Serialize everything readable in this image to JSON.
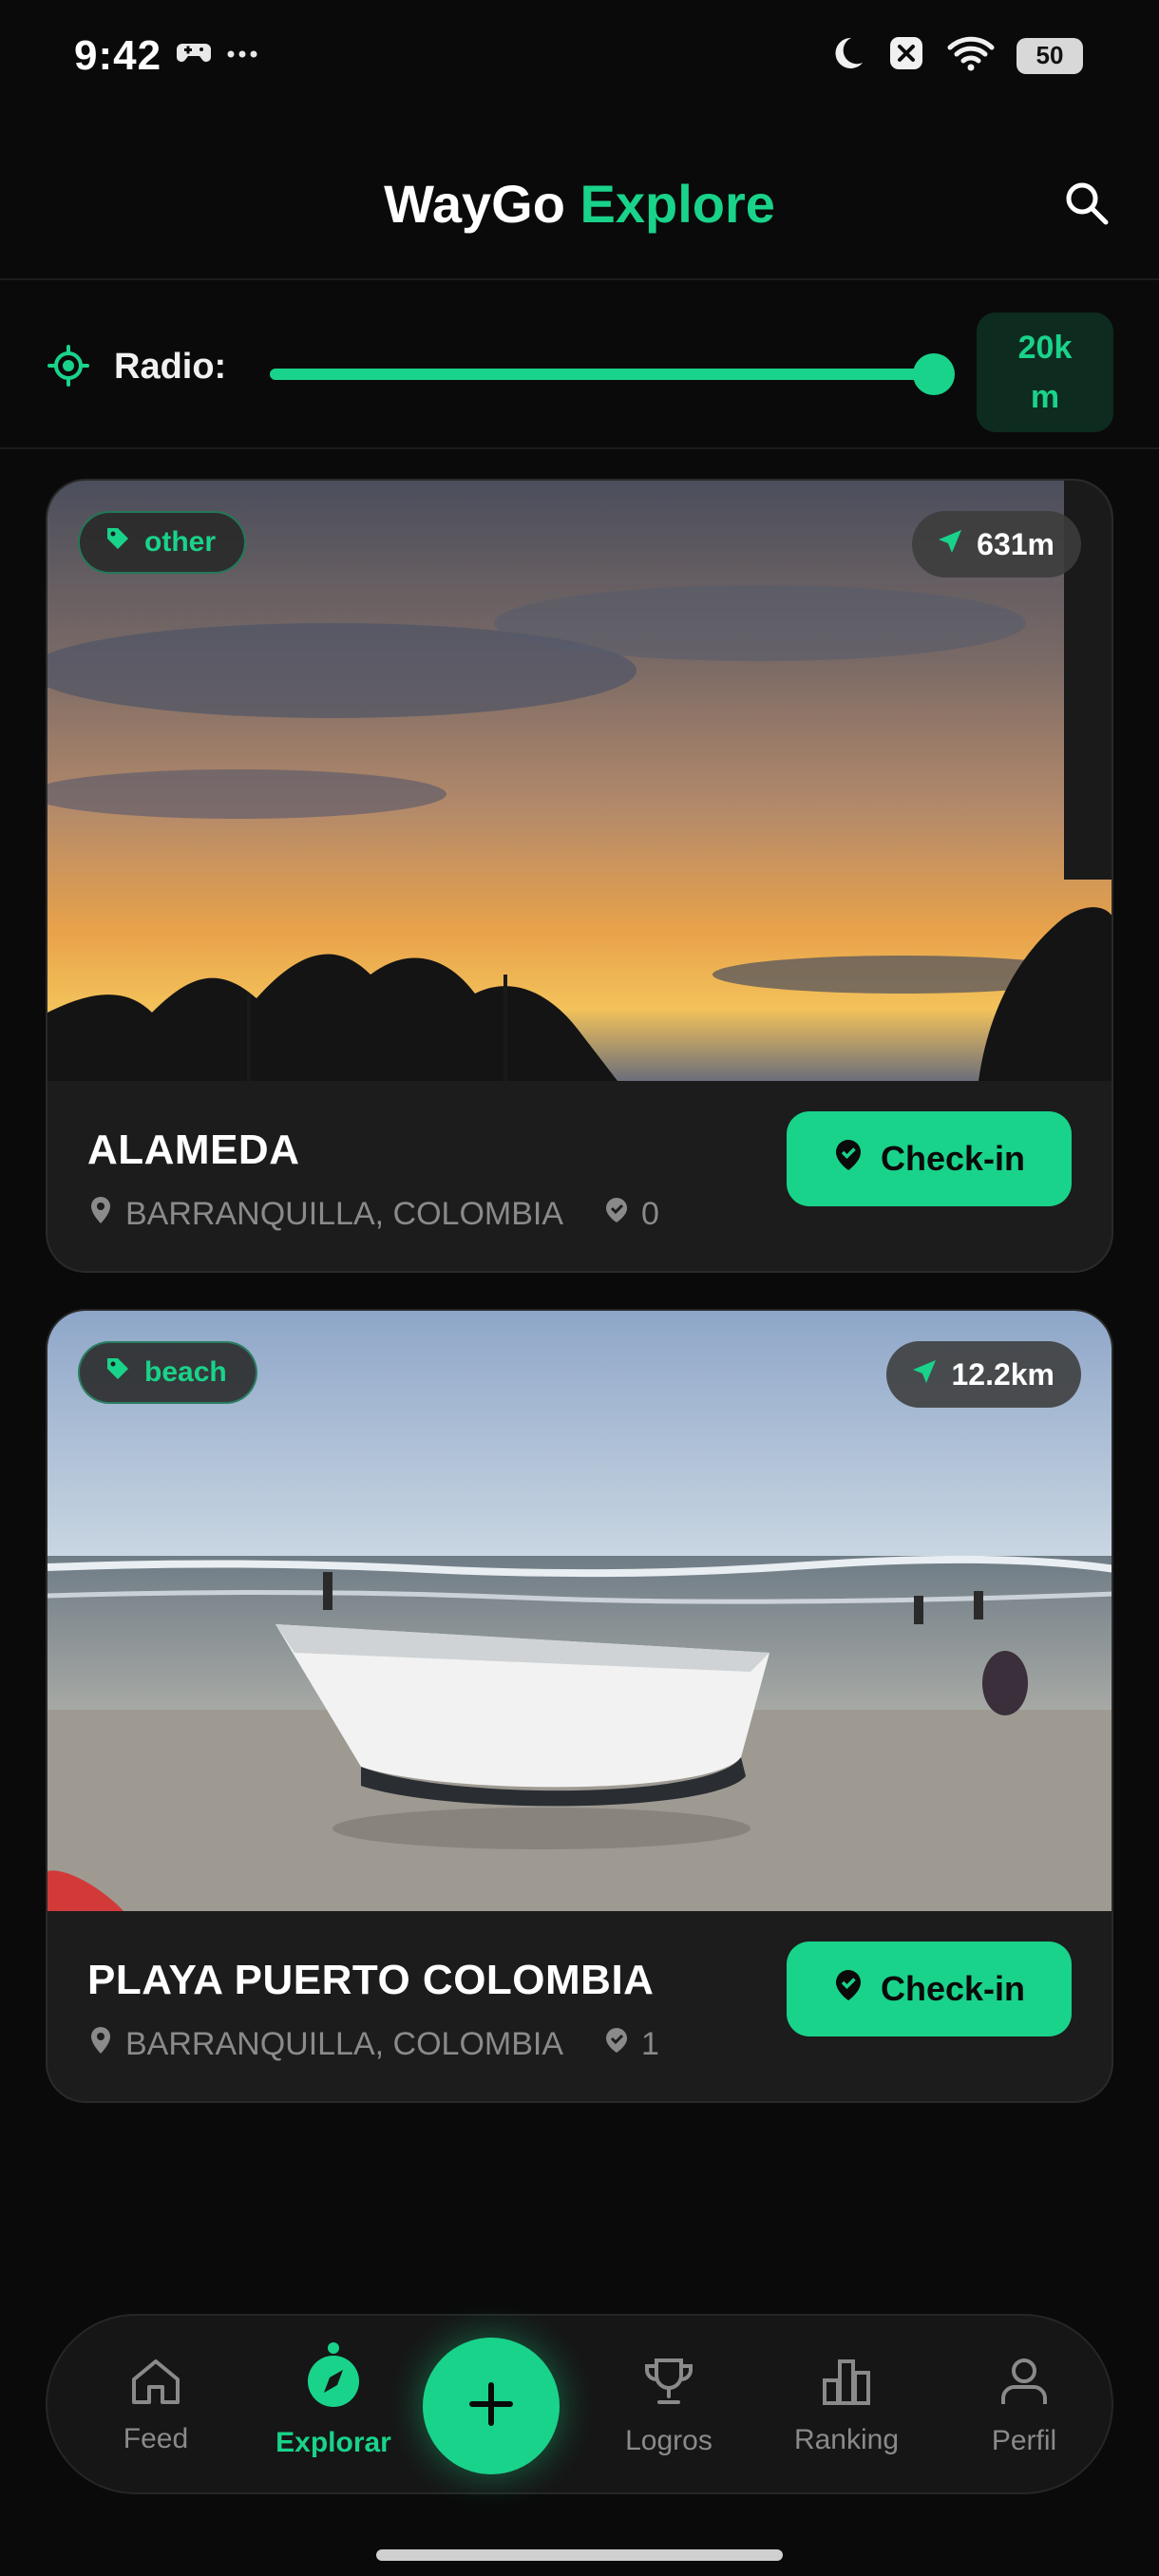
{
  "status_bar": {
    "time": "9:42",
    "battery": "50",
    "icons": [
      "game-controller-icon",
      "more-icon",
      "moon-icon",
      "close-box-icon",
      "wifi-icon"
    ]
  },
  "header": {
    "title_part1": "WayGo",
    "title_part2": "Explore",
    "search_icon": "search-icon"
  },
  "radius": {
    "label": "Radio:",
    "value_line1": "20k",
    "value_line2": "m",
    "slider_fraction": 1.0
  },
  "places": [
    {
      "tag": "other",
      "distance": "631m",
      "name": "ALAMEDA",
      "location": "BARRANQUILLA, COLOMBIA",
      "checkins": "0",
      "checkin_label": "Check-in"
    },
    {
      "tag": "beach",
      "distance": "12.2km",
      "name": "PLAYA PUERTO COLOMBIA",
      "location": "BARRANQUILLA, COLOMBIA",
      "checkins": "1",
      "checkin_label": "Check-in"
    }
  ],
  "nav": {
    "items": [
      {
        "label": "Feed",
        "icon": "home-icon"
      },
      {
        "label": "Explorar",
        "icon": "compass-icon"
      },
      {
        "label": "Logros",
        "icon": "trophy-icon"
      },
      {
        "label": "Ranking",
        "icon": "bar-chart-icon"
      },
      {
        "label": "Perfil",
        "icon": "user-icon"
      }
    ],
    "active_index": 1
  },
  "colors": {
    "accent": "#19d38a",
    "background": "#0a0a0a",
    "card": "#1c1c1c"
  }
}
